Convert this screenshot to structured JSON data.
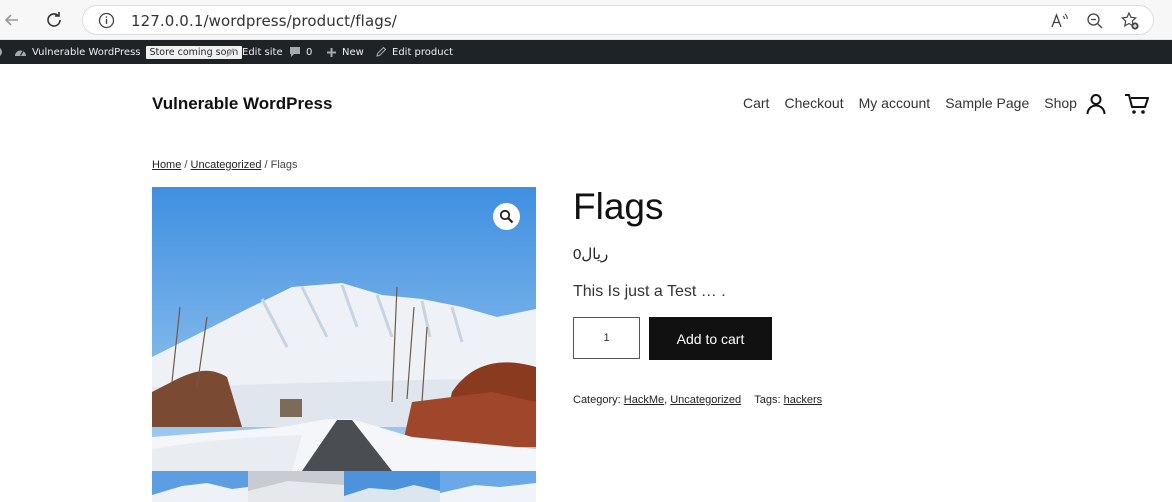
{
  "browser": {
    "url": "127.0.0.1/wordpress/product/flags/",
    "icons": [
      "back-arrow-icon",
      "reload-icon",
      "info-icon",
      "read-aloud-icon",
      "zoom-out-icon",
      "favorites-add-icon"
    ]
  },
  "adminbar": {
    "site_name": "Vulnerable WordPress",
    "store_badge": "Store coming soon",
    "edit_site": "Edit site",
    "comments_count": "0",
    "new_label": "New",
    "edit_product": "Edit product"
  },
  "header": {
    "site_title": "Vulnerable WordPress",
    "nav": [
      "Cart",
      "Checkout",
      "My account",
      "Sample Page",
      "Shop"
    ]
  },
  "breadcrumb": {
    "home": "Home",
    "category": "Uncategorized",
    "current": "Flags",
    "sep": " / "
  },
  "product": {
    "title": "Flags",
    "price": "0ریال",
    "short_description": "This Is just a Test … .",
    "quantity": "1",
    "add_to_cart": "Add to cart",
    "category_label": "Category:",
    "categories": [
      "HackMe",
      "Uncategorized"
    ],
    "tags_label": "Tags:",
    "tags": [
      "hackers"
    ]
  },
  "colors": {
    "admin_bar": "#1d2327",
    "button": "#111111",
    "sky": "#5aa3e6"
  }
}
